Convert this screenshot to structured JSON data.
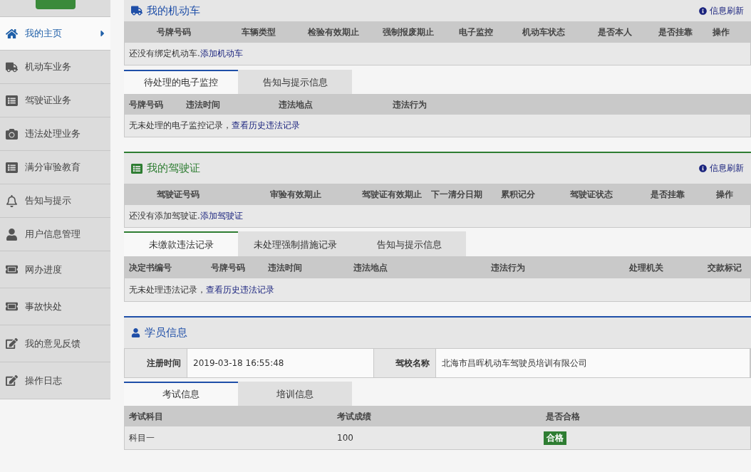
{
  "sidebar": {
    "items": [
      {
        "label": "我的主页",
        "selected": true
      },
      {
        "label": "机动车业务",
        "selected": false
      },
      {
        "label": "驾驶证业务",
        "selected": false
      },
      {
        "label": "违法处理业务",
        "selected": false
      },
      {
        "label": "满分审验教育",
        "selected": false
      },
      {
        "label": "告知与提示",
        "selected": false
      },
      {
        "label": "用户信息管理",
        "selected": false
      },
      {
        "label": "网办进度",
        "selected": false
      },
      {
        "label": "事故快处",
        "selected": false
      },
      {
        "label": "我的意见反馈",
        "selected": false
      },
      {
        "label": "操作日志",
        "selected": false
      }
    ]
  },
  "vehicle_panel": {
    "title": "我的机动车",
    "refresh": "信息刷新",
    "table": {
      "columns": [
        "号牌号码",
        "车辆类型",
        "检验有效期止",
        "强制报废期止",
        "电子监控",
        "机动车状态",
        "是否本人",
        "是否挂靠",
        "操作"
      ],
      "message": "还没有绑定机动车.",
      "link": "添加机动车"
    },
    "tabs": [
      {
        "label": "待处理的电子监控",
        "selected": true
      },
      {
        "label": "告知与提示信息",
        "selected": false
      }
    ],
    "tab_table": {
      "columns": [
        "号牌号码",
        "违法时间",
        "违法地点",
        "违法行为"
      ],
      "message": "无未处理的电子监控记录，",
      "link": "查看历史违法记录"
    }
  },
  "license_panel": {
    "title": "我的驾驶证",
    "refresh": "信息刷新",
    "table": {
      "columns": [
        "驾驶证号码",
        "审验有效期止",
        "驾驶证有效期止",
        "下一清分日期",
        "累积记分",
        "驾驶证状态",
        "是否挂靠",
        "操作"
      ],
      "message": "还没有添加驾驶证.",
      "link": "添加驾驶证"
    },
    "tabs": [
      {
        "label": "未缴款违法记录",
        "selected": true
      },
      {
        "label": "未处理强制措施记录",
        "selected": false
      },
      {
        "label": "告知与提示信息",
        "selected": false
      }
    ],
    "tab_table": {
      "columns": [
        "决定书编号",
        "号牌号码",
        "违法时间",
        "违法地点",
        "违法行为",
        "处理机关",
        "交款标记"
      ],
      "message": "无未处理违法记录，",
      "link": "查看历史违法记录"
    }
  },
  "student_panel": {
    "title": "学员信息",
    "info": [
      {
        "label": "注册时间",
        "value": "2019-03-18 16:55:48"
      },
      {
        "label": "驾校名称",
        "value": "北海市昌晖机动车驾驶员培训有限公司"
      }
    ],
    "tabs": [
      {
        "label": "考试信息",
        "selected": true
      },
      {
        "label": "培训信息",
        "selected": false
      }
    ],
    "exam_table": {
      "columns": [
        "考试科目",
        "考试成绩",
        "是否合格"
      ],
      "rows": [
        {
          "subject": "科目一",
          "score": "100",
          "result": {
            "label": "合格",
            "passed": true
          }
        }
      ]
    }
  }
}
